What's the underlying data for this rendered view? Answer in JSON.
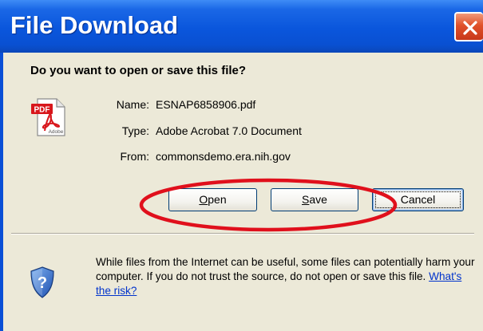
{
  "window": {
    "title": "File Download"
  },
  "dialog": {
    "question": "Do you want to open or save this file?",
    "file_icon": "pdf-file-icon",
    "file_icon_badge": "PDF",
    "file_icon_sub": "Adobe",
    "info": {
      "name_label": "Name:",
      "name_value": "ESNAP6858906.pdf",
      "type_label": "Type:",
      "type_value": "Adobe Acrobat 7.0 Document",
      "from_label": "From:",
      "from_value": "commonsdemo.era.nih.gov"
    },
    "buttons": {
      "open_mnemonic": "O",
      "open_rest": "pen",
      "save_mnemonic": "S",
      "save_rest": "ave",
      "cancel": "Cancel"
    },
    "warning": {
      "icon": "security-shield-question-icon",
      "text": "While files from the Internet can be useful, some files can potentially harm your computer. If you do not trust the source, do not open or save this file.",
      "link": "What's the risk?"
    }
  },
  "annotation": {
    "shape": "ellipse",
    "color": "#e0101c"
  },
  "colors": {
    "titlebar": "#0a56dc",
    "client": "#ece9d8",
    "close_button": "#e0512a",
    "link": "#0033cc"
  }
}
